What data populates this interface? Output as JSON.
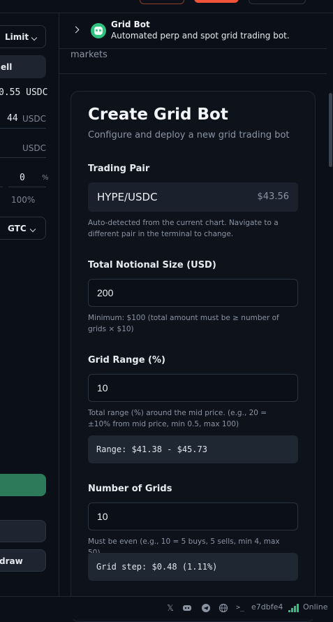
{
  "left": {
    "order_type": "Limit",
    "side_label": "ell",
    "available": "0.55 USDC",
    "price_value": "44",
    "price_unit": "USDC",
    "size_unit": "USDC",
    "pct_value": "0",
    "pct_symbol": "%",
    "pct_max": "100%",
    "tif": "GTC",
    "withdraw_label": "draw"
  },
  "header": {
    "title": "Grid Bot",
    "subtitle": "Automated perp and spot grid trading bot."
  },
  "markets_text": "markets",
  "card": {
    "title": "Create Grid Bot",
    "subtitle": "Configure and deploy a new grid trading bot",
    "pair_label": "Trading Pair",
    "pair": "HYPE/USDC",
    "pair_price": "$43.56",
    "pair_help": "Auto-detected from the current chart. Navigate to a different pair in the terminal to change.",
    "notional_label": "Total Notional Size (USD)",
    "notional_value": "200",
    "notional_help": "Minimum: $100 (total amount must be ≥ number of grids × $10)",
    "range_label": "Grid Range (%)",
    "range_value": "10",
    "range_help": "Total range (%) around the mid price. (e.g., 20 = ±10% from mid price, min 0.5, max 100)",
    "range_display": "Range: $41.38 - $45.73",
    "grids_label": "Number of Grids",
    "grids_value": "10",
    "grids_help": "Must be even (e.g., 10 = 5 buys, 5 sells, min 4, max 50)",
    "grid_step": "Grid step: $0.48 (1.11%)"
  },
  "status": {
    "commit_hash": "e7dbfe4",
    "connection": "Online"
  },
  "colors": {
    "accent_green": "#2ec27e",
    "danger": "#f0533a",
    "background": "#0b0f17"
  }
}
